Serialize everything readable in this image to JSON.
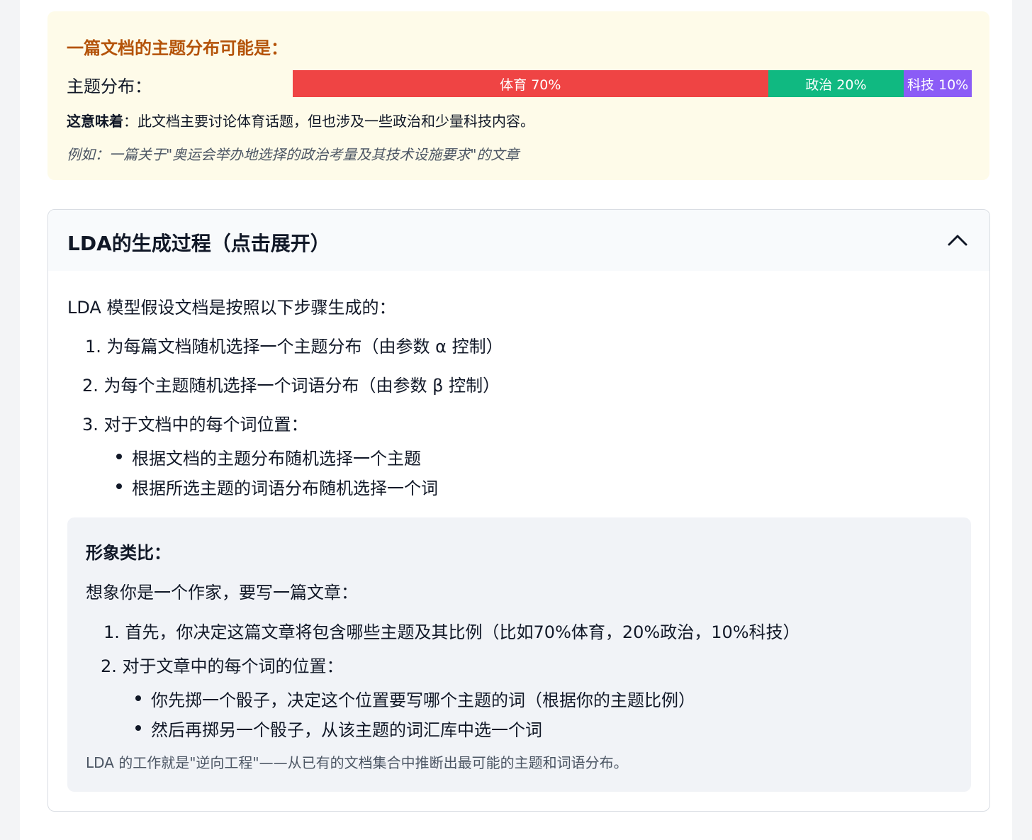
{
  "example": {
    "title": "一篇文档的主题分布可能是：",
    "distribution_label": "主题分布：",
    "segments": [
      {
        "label": "体育 70%",
        "value": 0.7,
        "color": "#ef4444"
      },
      {
        "label": "政治 20%",
        "value": 0.2,
        "color": "#10b981"
      },
      {
        "label": "科技 10%",
        "value": 0.1,
        "color": "#8b5cf6"
      }
    ],
    "meaning_bold": "这意味着",
    "meaning_text": "：此文档主要讨论体育话题，但也涉及一些政治和少量科技内容。",
    "note": "例如：一篇关于\"奥运会举办地选择的政治考量及其技术设施要求\"的文章"
  },
  "accordion": {
    "title": "LDA的生成过程（点击展开）",
    "toggle_icon": "chevron-up-icon",
    "intro": "LDA 模型假设文档是按照以下步骤生成的：",
    "steps": [
      "1. 为每篇文档随机选择一个主题分布（由参数 α 控制）",
      "2. 为每个主题随机选择一个词语分布（由参数 β 控制）",
      "3. 对于文档中的每个词位置："
    ],
    "sub_bullets": [
      "根据文档的主题分布随机选择一个主题",
      "根据所选主题的词语分布随机选择一个词"
    ],
    "analogy": {
      "title": "形象类比：",
      "intro": "想象你是一个作家，要写一篇文章：",
      "steps": [
        "1. 首先，你决定这篇文章将包含哪些主题及其比例（比如70%体育，20%政治，10%科技）",
        "2. 对于文章中的每个词的位置："
      ],
      "sub_bullets": [
        "你先掷一个骰子，决定这个位置要写哪个主题的词（根据你的主题比例）",
        "然后再掷另一个骰子，从该主题的词汇库中选一个词"
      ],
      "note": "LDA 的工作就是\"逆向工程\"——从已有的文档集合中推断出最可能的主题和词语分布。"
    }
  }
}
